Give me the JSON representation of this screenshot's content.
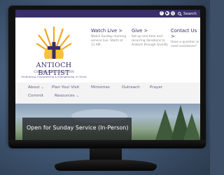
{
  "topbar": {
    "search_placeholder": "Search",
    "social_icons": [
      "facebook-icon",
      "youtube-icon",
      "instagram-icon"
    ],
    "color": "#3a2f6b"
  },
  "logo": {
    "name": "ANTIOCH BAPTIST",
    "subtitle": "CHURCH of CLINTON",
    "tagline": "Embracing, Empowering & Evangelizing in Christ"
  },
  "columns": [
    {
      "title": "Watch Live >",
      "text": "Watch Sunday morning service live. Starts at 11 AM."
    },
    {
      "title": "Give >",
      "text": "Set up one-time and recurring donations to Antioch through Givelify"
    },
    {
      "title": "Contact Us >",
      "text": "Have a question or need assistance?"
    }
  ],
  "nav": {
    "about": "About",
    "plan_visit": "Plan Your Visit",
    "ministries": "Ministries",
    "outreach": "Outreach",
    "prayer": "Prayer",
    "commit": "Commit",
    "resources": "Resources"
  },
  "hero": {
    "title": "Open for Sunday Service (In-Person)"
  }
}
